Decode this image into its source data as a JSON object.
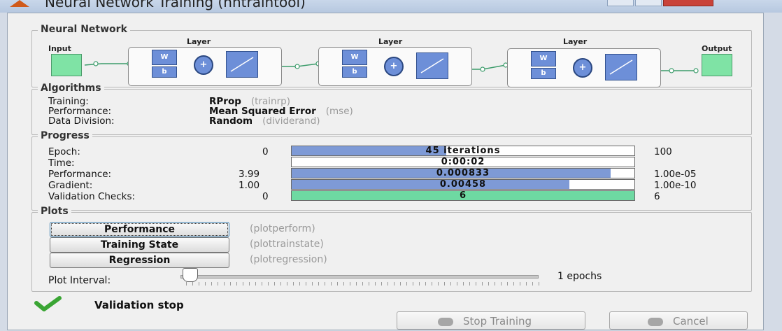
{
  "window": {
    "title": "Neural Network Training (nntraintool)"
  },
  "network": {
    "group_title": "Neural Network",
    "input_label": "Input",
    "output_label": "Output",
    "layers": [
      {
        "label": "Layer",
        "w": "W",
        "b": "b",
        "sum": "+"
      },
      {
        "label": "Layer",
        "w": "W",
        "b": "b",
        "sum": "+"
      },
      {
        "label": "Layer",
        "w": "W",
        "b": "b",
        "sum": "+"
      }
    ]
  },
  "algorithms": {
    "group_title": "Algorithms",
    "rows": [
      {
        "label": "Training:",
        "value": "RProp",
        "note": "(trainrp)"
      },
      {
        "label": "Performance:",
        "value": "Mean Squared Error",
        "note": "(mse)"
      },
      {
        "label": "Data Division:",
        "value": "Random",
        "note": "(dividerand)"
      }
    ]
  },
  "progress": {
    "group_title": "Progress",
    "rows": [
      {
        "label": "Epoch:",
        "start": "0",
        "bar_text": "45 iterations",
        "end": "100",
        "fill": 0.45,
        "color": "#7e9ad6"
      },
      {
        "label": "Time:",
        "start": "",
        "bar_text": "0:00:02",
        "end": "",
        "fill": 0,
        "color": "#7e9ad6"
      },
      {
        "label": "Performance:",
        "start": "3.99",
        "bar_text": "0.000833",
        "end": "1.00e-05",
        "fill": 0.93,
        "color": "#7e9ad6"
      },
      {
        "label": "Gradient:",
        "start": "1.00",
        "bar_text": "0.00458",
        "end": "1.00e-10",
        "fill": 0.81,
        "color": "#7e9ad6"
      },
      {
        "label": "Validation Checks:",
        "start": "0",
        "bar_text": "6",
        "end": "6",
        "fill": 1.0,
        "color": "#6ed9a2"
      }
    ]
  },
  "plots": {
    "group_title": "Plots",
    "buttons": [
      {
        "label": "Performance",
        "note": "(plotperform)"
      },
      {
        "label": "Training State",
        "note": "(plottrainstate)"
      },
      {
        "label": "Regression",
        "note": "(plotregression)"
      }
    ],
    "interval_label": "Plot Interval:",
    "interval_value": "1 epochs"
  },
  "status": {
    "message": "Validation stop",
    "icon": "check-icon",
    "icon_color": "#3aa534"
  },
  "actions": {
    "stop_label": "Stop Training",
    "cancel_label": "Cancel"
  }
}
